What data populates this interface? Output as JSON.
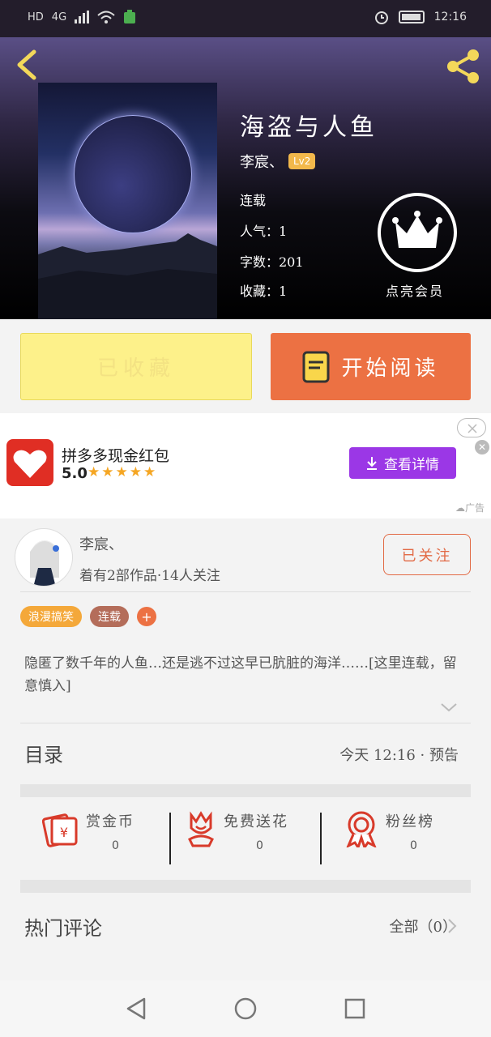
{
  "status_bar": {
    "network": "HD",
    "signal": "4G",
    "time": "12:16"
  },
  "book": {
    "title": "海盗与人鱼",
    "author": "李宸、",
    "author_level": "Lv2",
    "status": "连载",
    "popularity": "人气：1",
    "word_count": "字数：201",
    "favorites": "收藏：1",
    "crown_label": "点亮会员"
  },
  "actions": {
    "collected_label": "已收藏",
    "read_label": "开始阅读"
  },
  "ad": {
    "title": "拼多多现金红包",
    "rating": "5.0",
    "stars": "★★★★★",
    "button_label": "查看详情",
    "ad_tag": "☁广告"
  },
  "author_card": {
    "name": "李宸、",
    "stats": "着有2部作品·14人关注",
    "follow_label": "已关注"
  },
  "tags": [
    {
      "label": "浪漫搞笑",
      "color": "#f4a83a"
    },
    {
      "label": "连载",
      "color": "#b46d5a"
    }
  ],
  "tag_add": "+",
  "description": "隐匿了数千年的人鱼…还是逃不过这早已肮脏的海洋……[这里连载，留意慎入]",
  "catalog": {
    "label": "目录",
    "update": "今天 12:16 · 预告"
  },
  "gifts": [
    {
      "label": "赏金币",
      "count": "0",
      "icon": "red-envelope-icon"
    },
    {
      "label": "免费送花",
      "count": "0",
      "icon": "flower-icon"
    },
    {
      "label": "粉丝榜",
      "count": "0",
      "icon": "medal-icon"
    }
  ],
  "comments": {
    "label": "热门评论",
    "all_label": "全部（0）"
  }
}
